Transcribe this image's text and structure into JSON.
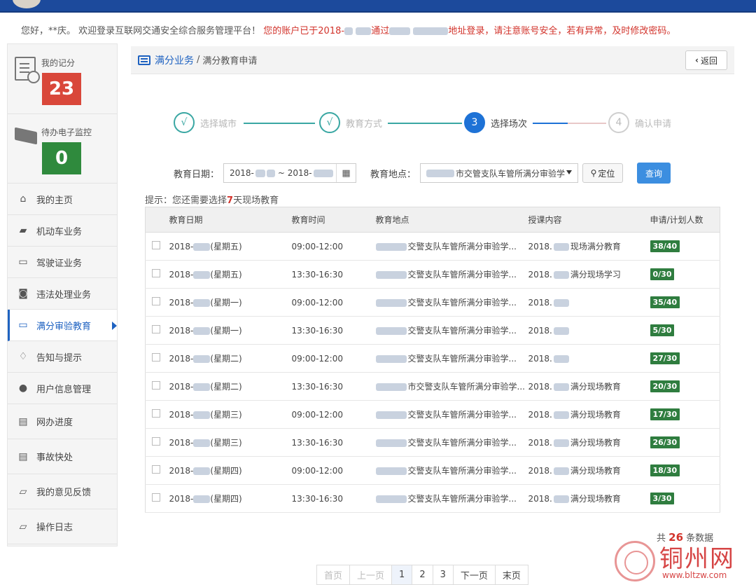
{
  "welcome": {
    "part1": "您好，**庆。 欢迎登录互联网交通安全综合服务管理平台！",
    "part2": "您的账户已于2018-",
    "part3": "通过",
    "part4": "地址登录，请注意账号安全，若有异常，及时修改密码。"
  },
  "sidebar": {
    "score_label": "我的记分",
    "score_value": "23",
    "monitor_label": "待办电子监控",
    "monitor_value": "0",
    "items": [
      {
        "label": "我的主页",
        "icon": "home-icon",
        "glyph": "⌂"
      },
      {
        "label": "机动车业务",
        "icon": "truck-icon",
        "glyph": "▰"
      },
      {
        "label": "驾驶证业务",
        "icon": "card-icon",
        "glyph": "▭"
      },
      {
        "label": "违法处理业务",
        "icon": "camera-icon",
        "glyph": "◙"
      },
      {
        "label": "满分审验教育",
        "icon": "monitor-icon",
        "glyph": "▭"
      },
      {
        "label": "告知与提示",
        "icon": "bell-icon",
        "glyph": "♢"
      },
      {
        "label": "用户信息管理",
        "icon": "user-icon",
        "glyph": "●"
      },
      {
        "label": "网办进度",
        "icon": "progress-icon",
        "glyph": "▤"
      },
      {
        "label": "事故快处",
        "icon": "accident-icon",
        "glyph": "▤"
      },
      {
        "label": "我的意见反馈",
        "icon": "feedback-icon",
        "glyph": "▱"
      },
      {
        "label": "操作日志",
        "icon": "log-icon",
        "glyph": "▱"
      }
    ]
  },
  "breadcrumb": {
    "section": "满分业务",
    "page": "满分教育申请",
    "back_label": "返回"
  },
  "steps": [
    {
      "mark": "√",
      "label": "选择城市"
    },
    {
      "mark": "√",
      "label": "教育方式"
    },
    {
      "mark": "3",
      "label": "选择场次"
    },
    {
      "mark": "4",
      "label": "确认申请"
    }
  ],
  "filter": {
    "date_label": "教育日期：",
    "date_from": "2018-",
    "date_sep": "~ 2018-",
    "place_label": "教育地点：",
    "place_value": "市交管支队车管所满分审验学",
    "locate_label": "定位",
    "query_label": "查询"
  },
  "tip": {
    "prefix": "提示：您还需要选择",
    "days": "7",
    "suffix": "天现场教育"
  },
  "table": {
    "headers": [
      "教育日期",
      "教育时间",
      "教育地点",
      "授课内容",
      "申请/计划人数"
    ],
    "rows": [
      {
        "date": "2018-",
        "weekday": "(星期五)",
        "time": "09:00-12:00",
        "place": "交警支队车管所满分审验学...",
        "content": "2018.",
        "content_suffix": "现场满分教育",
        "count": "38/40"
      },
      {
        "date": "2018-",
        "weekday": "(星期五)",
        "time": "13:30-16:30",
        "place": "交警支队车管所满分审验学...",
        "content": "2018.",
        "content_suffix": "满分现场学习",
        "count": "0/30"
      },
      {
        "date": "2018-",
        "weekday": "(星期一)",
        "time": "09:00-12:00",
        "place": "交警支队车管所满分审验学...",
        "content": "2018.",
        "content_suffix": "",
        "count": "35/40"
      },
      {
        "date": "2018-",
        "weekday": "(星期一)",
        "time": "13:30-16:30",
        "place": "交警支队车管所满分审验学...",
        "content": "2018.",
        "content_suffix": "",
        "count": "5/30"
      },
      {
        "date": "2018-",
        "weekday": "(星期二)",
        "time": "09:00-12:00",
        "place": "交警支队车管所满分审验学...",
        "content": "2018.",
        "content_suffix": "",
        "count": "27/30"
      },
      {
        "date": "2018-",
        "weekday": "(星期二)",
        "time": "13:30-16:30",
        "place": "市交警支队车管所满分审验学...",
        "content": "2018.",
        "content_suffix": "满分现场教育",
        "count": "20/30"
      },
      {
        "date": "2018-",
        "weekday": "(星期三)",
        "time": "09:00-12:00",
        "place": "交警支队车管所满分审验学...",
        "content": "2018.",
        "content_suffix": "满分现场教育",
        "count": "17/30"
      },
      {
        "date": "2018-",
        "weekday": "(星期三)",
        "time": "13:30-16:30",
        "place": "交警支队车管所满分审验学...",
        "content": "2018.",
        "content_suffix": "满分现场教育",
        "count": "26/30"
      },
      {
        "date": "2018-",
        "weekday": "(星期四)",
        "time": "09:00-12:00",
        "place": "交警支队车管所满分审验学...",
        "content": "2018.",
        "content_suffix": "满分现场教育",
        "count": "18/30"
      },
      {
        "date": "2018-",
        "weekday": "(星期四)",
        "time": "13:30-16:30",
        "place": "交警支队车管所满分审验学...",
        "content": "2018.",
        "content_suffix": "满分现场教育",
        "count": "3/30"
      }
    ]
  },
  "total": {
    "prefix": "共",
    "count": "26",
    "suffix": "条数据"
  },
  "pager": [
    "首页",
    "上一页",
    "1",
    "2",
    "3",
    "下一页",
    "末页"
  ],
  "watermark": {
    "brand": "铜州网",
    "url": "www.bltzw.com"
  }
}
